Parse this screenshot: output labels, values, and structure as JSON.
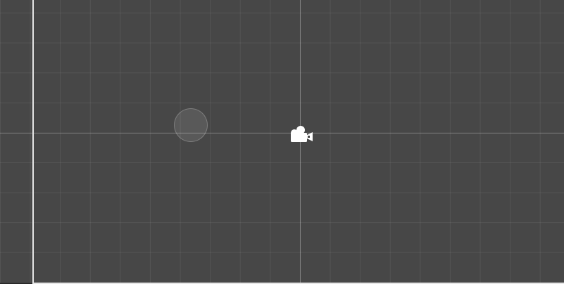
{
  "scene_view": {
    "background_color": "#474747",
    "grid_color": "#565656",
    "border_color": "#e6e6e6"
  },
  "gizmos": {
    "camera": {
      "icon": "camera-icon",
      "color": "#ffffff"
    },
    "circle": {
      "icon": "circle-gizmo-icon"
    }
  }
}
